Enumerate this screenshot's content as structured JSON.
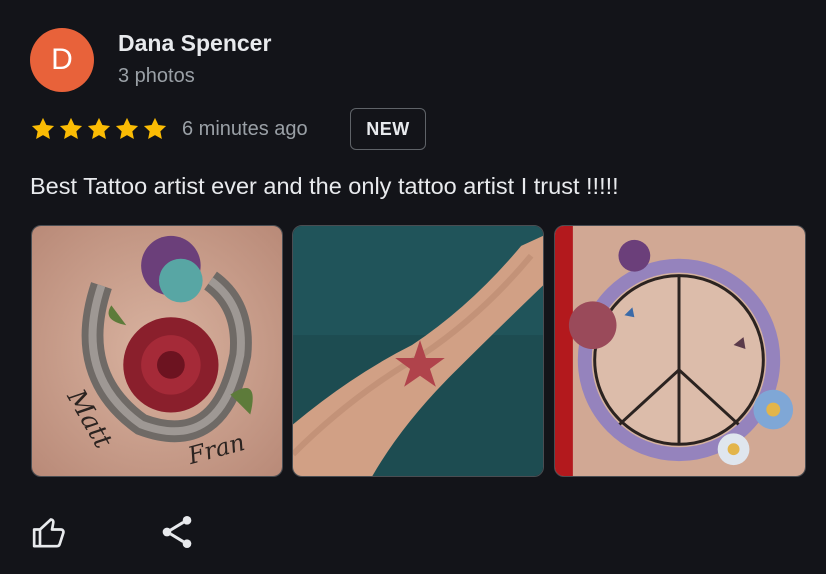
{
  "reviewer": {
    "initial": "D",
    "avatar_color": "#e8623a",
    "name": "Dana Spencer",
    "meta": "3 photos"
  },
  "rating": {
    "stars": 5,
    "star_color": "#fbbc04",
    "time": "6 minutes ago",
    "badge": "NEW"
  },
  "review": {
    "text": "Best Tattoo artist ever and the only tattoo artist I trust !!!!!"
  },
  "photos": [
    {
      "icon": "tattoo-photo-roses-horseshoe"
    },
    {
      "icon": "tattoo-photo-star-arm"
    },
    {
      "icon": "tattoo-photo-peace-sign"
    }
  ],
  "actions": [
    {
      "icon": "thumbs-up-icon"
    },
    {
      "icon": "share-icon"
    }
  ]
}
